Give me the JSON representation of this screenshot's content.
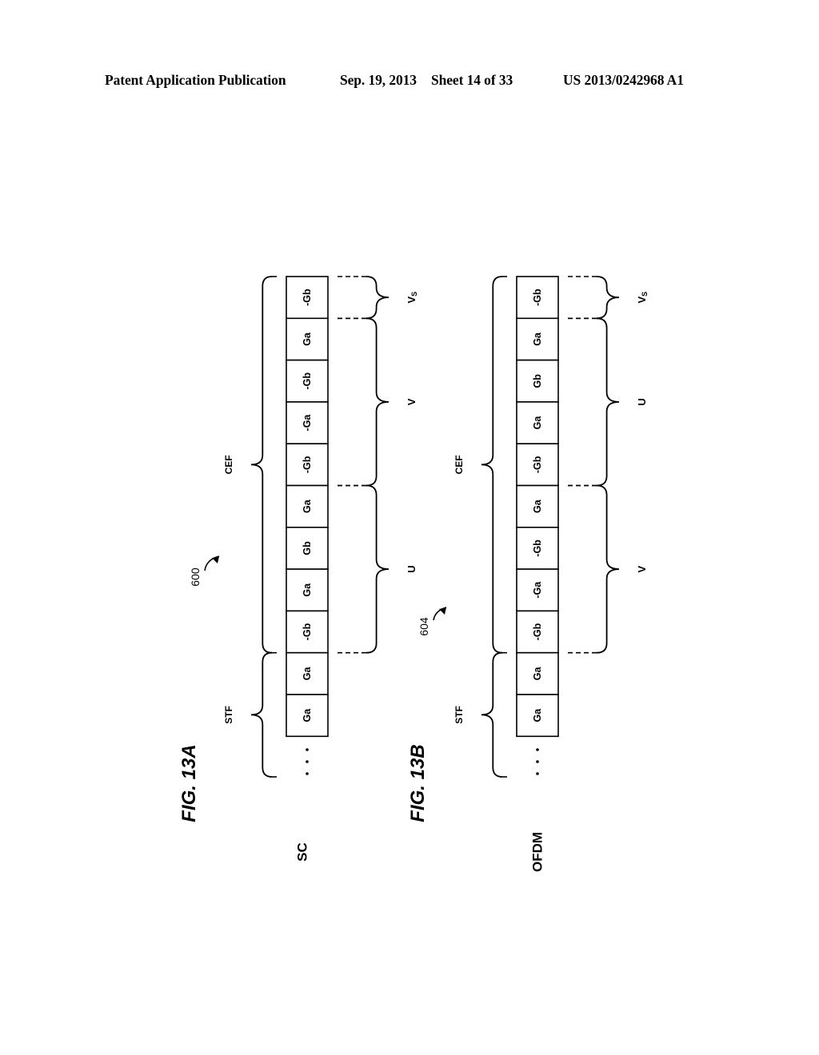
{
  "header": {
    "publication": "Patent Application Publication",
    "date": "Sep. 19, 2013",
    "sheet": "Sheet 14 of 33",
    "number": "US 2013/0242968 A1"
  },
  "figures": [
    {
      "id": "13A",
      "title": "FIG. 13A",
      "title_prefix": "FIG.",
      "title_suffix": "13A",
      "mode_label": "SC",
      "reference": "600",
      "ellipsis": "...",
      "cells_top_to_bottom": [
        "-Gb",
        "Ga",
        "-Gb",
        "-Ga",
        "-Gb",
        "Ga",
        "Gb",
        "Ga",
        "-Gb",
        "Ga",
        "Ga"
      ],
      "left_braces": [
        {
          "label": "CEF",
          "from_cell": 0,
          "to_cell": 8,
          "dashed_top": true,
          "dashed_bottom": true
        },
        {
          "label": "STF",
          "from_cell": 9,
          "to_cell": 11,
          "dashed_top": false,
          "dashed_bottom": true
        }
      ],
      "right_braces": [
        {
          "label": "V",
          "subscript": "S",
          "from_cell": 0,
          "to_cell": 0
        },
        {
          "label": "V",
          "subscript": "",
          "from_cell": 1,
          "to_cell": 4
        },
        {
          "label": "U",
          "subscript": "",
          "from_cell": 5,
          "to_cell": 8
        }
      ]
    },
    {
      "id": "13B",
      "title": "FIG. 13B",
      "title_prefix": "FIG.",
      "title_suffix": "13B",
      "mode_label": "OFDM",
      "reference": "604",
      "ellipsis": "...",
      "cells_top_to_bottom": [
        "-Gb",
        "Ga",
        "Gb",
        "Ga",
        "-Gb",
        "Ga",
        "-Gb",
        "-Ga",
        "-Gb",
        "Ga",
        "Ga"
      ],
      "left_braces": [
        {
          "label": "CEF",
          "from_cell": 0,
          "to_cell": 8,
          "dashed_top": true,
          "dashed_bottom": true
        },
        {
          "label": "STF",
          "from_cell": 9,
          "to_cell": 11,
          "dashed_top": false,
          "dashed_bottom": true
        }
      ],
      "right_braces": [
        {
          "label": "V",
          "subscript": "S",
          "from_cell": 0,
          "to_cell": 0
        },
        {
          "label": "U",
          "subscript": "",
          "from_cell": 1,
          "to_cell": 4
        },
        {
          "label": "V",
          "subscript": "",
          "from_cell": 5,
          "to_cell": 8
        }
      ]
    }
  ]
}
